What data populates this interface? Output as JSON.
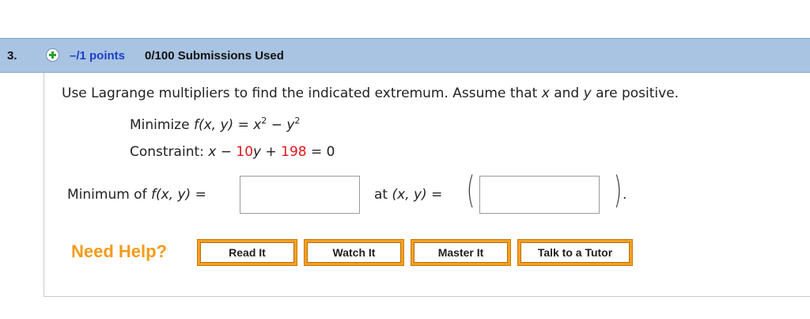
{
  "question": {
    "number": "3.",
    "points": "–/1 points",
    "submissions": "0/100 Submissions Used",
    "add_icon": "plus-circle-icon"
  },
  "instruction": {
    "prefix": "Use Lagrange multipliers to find the indicated extremum. Assume that",
    "var_x": "x",
    "and": "and",
    "var_y": "y",
    "suffix": "are positive."
  },
  "problem": {
    "minimize_label": "Minimize",
    "function": "f(x, y)",
    "eq": "=",
    "term1_base": "x",
    "term1_exp": "2",
    "minus": "−",
    "term2_base": "y",
    "term2_exp": "2",
    "constraint_label": "Constraint:",
    "c_x": "x",
    "c_minus": "−",
    "c_coef": "10",
    "c_y": "y",
    "c_plus": "+",
    "c_const": "198",
    "c_eq": "= 0"
  },
  "answer": {
    "minimum_label": "Minimum of",
    "function": "f(x, y)",
    "eq": "=",
    "minimum_value": "",
    "at_label": "at",
    "point_vars": "(x, y)",
    "at_eq": "=",
    "open_paren": "(",
    "close_paren": ")",
    "point_value": "",
    "period": "."
  },
  "help": {
    "label": "Need Help?",
    "buttons": [
      "Read It",
      "Watch It",
      "Master It",
      "Talk to a Tutor"
    ]
  },
  "colors": {
    "header_bg": "#a9c4e2",
    "points_blue": "#1a3fc8",
    "highlight_red": "#e0161b",
    "help_orange": "#f39c1a"
  }
}
